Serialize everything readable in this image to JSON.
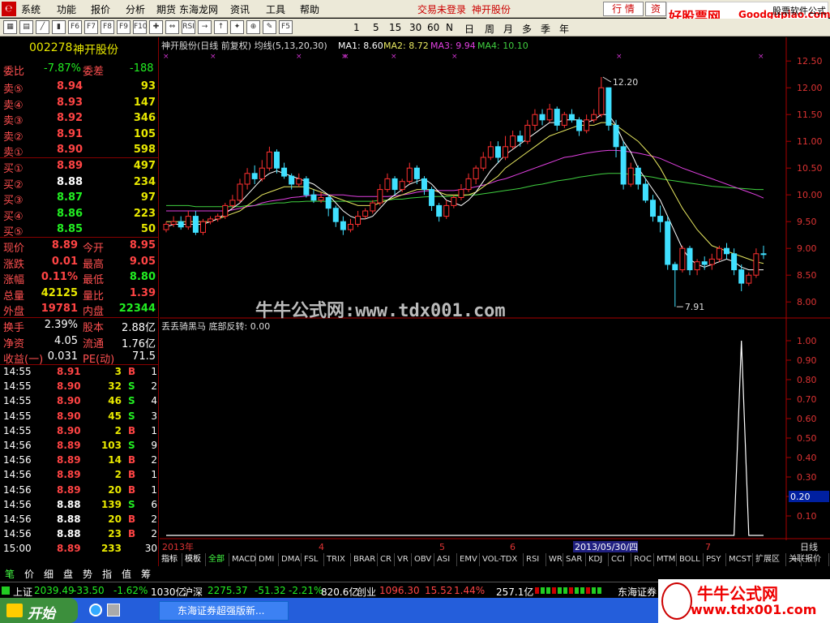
{
  "menubar": {
    "items": [
      "系统",
      "功能",
      "报价",
      "分析",
      "期货",
      "东海龙网",
      "资讯",
      "工具",
      "帮助"
    ],
    "status": "交易未登录",
    "stock_name": "神开股份",
    "btn_quote": "行 情",
    "btn_trade": "资"
  },
  "watermark_top": {
    "text1": "好股票网",
    "text2": "Goodgupiao.com",
    "corner": "股票软件公式"
  },
  "toolbar": {
    "icons": [
      "grid-icon",
      "table-icon",
      "line-icon",
      "bar-icon",
      "F6",
      "F7",
      "F8",
      "F9",
      "F10",
      "cross-icon",
      "arrows-icon",
      "RSI",
      "right-icon",
      "up-icon",
      "pin-icon",
      "zoom-icon",
      "pen-icon",
      "F5"
    ],
    "periods": [
      "1",
      "5",
      "15",
      "30",
      "60",
      "N",
      "日",
      "周",
      "月",
      "多",
      "季",
      "年"
    ]
  },
  "stock": {
    "code": "002278",
    "name": "神开股份"
  },
  "quote": {
    "weibi_label": "委比",
    "weibi": "-7.87%",
    "weicha_label": "委差",
    "weicha": "-188",
    "sell": [
      {
        "label": "卖⑤",
        "price": "8.94",
        "vol": "93"
      },
      {
        "label": "卖④",
        "price": "8.93",
        "vol": "147"
      },
      {
        "label": "卖③",
        "price": "8.92",
        "vol": "346"
      },
      {
        "label": "卖②",
        "price": "8.91",
        "vol": "105"
      },
      {
        "label": "卖①",
        "price": "8.90",
        "vol": "598"
      }
    ],
    "buy": [
      {
        "label": "买①",
        "price": "8.89",
        "vol": "497"
      },
      {
        "label": "买②",
        "price": "8.88",
        "vol": "234"
      },
      {
        "label": "买③",
        "price": "8.87",
        "vol": "97"
      },
      {
        "label": "买④",
        "price": "8.86",
        "vol": "223"
      },
      {
        "label": "买⑤",
        "price": "8.85",
        "vol": "50"
      }
    ],
    "stats": [
      {
        "l1": "现价",
        "v1": "8.89",
        "l2": "今开",
        "v2": "8.95"
      },
      {
        "l1": "涨跌",
        "v1": "0.01",
        "l2": "最高",
        "v2": "9.05"
      },
      {
        "l1": "涨幅",
        "v1": "0.11%",
        "l2": "最低",
        "v2": "8.80"
      },
      {
        "l1": "总量",
        "v1": "42125",
        "l2": "量比",
        "v2": "1.39"
      },
      {
        "l1": "外盘",
        "v1": "19781",
        "l2": "内盘",
        "v2": "22344"
      }
    ],
    "fund": [
      {
        "l1": "换手",
        "v1": "2.39%",
        "l2": "股本",
        "v2": "2.88亿"
      },
      {
        "l1": "净资",
        "v1": "4.05",
        "l2": "流通",
        "v2": "1.76亿"
      },
      {
        "l1": "收益(一)",
        "v1": "0.031",
        "l2": "PE(动)",
        "v2": "71.5"
      }
    ]
  },
  "ticks": [
    {
      "t": "14:55",
      "p": "8.91",
      "v": "3",
      "s": "B",
      "n": "1"
    },
    {
      "t": "14:55",
      "p": "8.90",
      "v": "32",
      "s": "S",
      "n": "2"
    },
    {
      "t": "14:55",
      "p": "8.90",
      "v": "46",
      "s": "S",
      "n": "4"
    },
    {
      "t": "14:55",
      "p": "8.90",
      "v": "45",
      "s": "S",
      "n": "3"
    },
    {
      "t": "14:55",
      "p": "8.90",
      "v": "2",
      "s": "B",
      "n": "1"
    },
    {
      "t": "14:56",
      "p": "8.89",
      "v": "103",
      "s": "S",
      "n": "9"
    },
    {
      "t": "14:56",
      "p": "8.89",
      "v": "14",
      "s": "B",
      "n": "2"
    },
    {
      "t": "14:56",
      "p": "8.89",
      "v": "2",
      "s": "B",
      "n": "1"
    },
    {
      "t": "14:56",
      "p": "8.89",
      "v": "20",
      "s": "B",
      "n": "1"
    },
    {
      "t": "14:56",
      "p": "8.88",
      "v": "139",
      "s": "S",
      "n": "6"
    },
    {
      "t": "14:56",
      "p": "8.88",
      "v": "20",
      "s": "B",
      "n": "2"
    },
    {
      "t": "14:56",
      "p": "8.88",
      "v": "23",
      "s": "B",
      "n": "2"
    },
    {
      "t": "15:00",
      "p": "8.89",
      "v": "233",
      "s": "",
      "n": "30"
    }
  ],
  "chart": {
    "title": "神开股份(日线 前复权) 均线(5,13,20,30)",
    "ma1": "MA1: 8.60",
    "ma2": "MA2: 8.72",
    "ma3": "MA3: 9.94",
    "ma4": "MA4: 10.10",
    "high_label": "12.20",
    "low_label": "7.91",
    "watermark": "牛牛公式网:www.tdx001.com",
    "price_ticks": [
      "12.50",
      "12.00",
      "11.50",
      "11.00",
      "10.50",
      "10.00",
      "9.50",
      "9.00",
      "8.50",
      "8.00"
    ],
    "indicator_title": "丢丢骑黑马 底部反转: 0.00",
    "ind_ticks": [
      "1.00",
      "0.90",
      "0.80",
      "0.70",
      "0.60",
      "0.50",
      "0.40",
      "0.30",
      "0.20",
      "0.10"
    ],
    "ind_cursor": "0.20",
    "date_labels": [
      "2013年",
      "4",
      "5",
      "6",
      "7"
    ],
    "date_cursor": "2013/05/30/四",
    "period_label": "日线",
    "colors": {
      "up": "#ff3030",
      "down": "#40e0ff",
      "ma1": "#ffffff",
      "ma2": "#e8e860",
      "ma3": "#e040e0",
      "ma4": "#40d040"
    }
  },
  "indicator_tabs": [
    "指标",
    "模板",
    "全部",
    "MACD",
    "DMI",
    "DMA",
    "FSL",
    "TRIX",
    "BRAR",
    "CR",
    "VR",
    "OBV",
    "ASI",
    "EMV",
    "VOL-TDX",
    "RSI",
    "WR",
    "SAR",
    "KDJ",
    "CCI",
    "ROC",
    "MTM",
    "BOLL",
    "PSY",
    "MCST",
    "扩展区",
    "关联报价"
  ],
  "tab_nav": [
    "+",
    "-"
  ],
  "left_tabs": [
    "笔",
    "价",
    "细",
    "盘",
    "势",
    "指",
    "值",
    "筹"
  ],
  "index_bar": [
    {
      "name": "上证",
      "val": "2039.49",
      "chg": "-33.50",
      "pct": "-1.62%",
      "amt": "1030亿"
    },
    {
      "name": "沪深",
      "val": "2275.37",
      "chg": "-51.32",
      "pct": "-2.21%",
      "amt": "820.6亿"
    },
    {
      "name": "创业",
      "val": "1096.30",
      "chg": "15.52",
      "pct": "1.44%",
      "amt": "257.1亿"
    }
  ],
  "broker": "东海证券",
  "taskbar": {
    "start": "开始",
    "task1": "东海证券超强版新..."
  },
  "watermark_bottom": {
    "text1": "牛牛公式网",
    "text2": "www.tdx001.com"
  },
  "chart_data": {
    "type": "candlestick",
    "title": "神开股份(日线 前复权) 均线(5,13,20,30)",
    "ylim": [
      7.7,
      12.7
    ],
    "indicator_ylim": [
      0,
      1.05
    ],
    "candles": [
      [
        9.35,
        9.45,
        9.3,
        9.5
      ],
      [
        9.45,
        9.5,
        9.4,
        9.6
      ],
      [
        9.5,
        9.4,
        9.35,
        9.6
      ],
      [
        9.4,
        9.6,
        9.35,
        9.7
      ],
      [
        9.6,
        9.3,
        9.25,
        9.7
      ],
      [
        9.3,
        9.5,
        9.25,
        9.55
      ],
      [
        9.5,
        9.55,
        9.45,
        9.6
      ],
      [
        9.55,
        9.6,
        9.5,
        9.65
      ],
      [
        9.6,
        9.8,
        9.55,
        9.85
      ],
      [
        9.8,
        9.9,
        9.75,
        10.0
      ],
      [
        9.9,
        10.2,
        9.85,
        10.3
      ],
      [
        10.2,
        10.4,
        10.1,
        10.5
      ],
      [
        10.4,
        10.3,
        10.2,
        10.55
      ],
      [
        10.3,
        10.5,
        10.25,
        10.65
      ],
      [
        10.5,
        10.8,
        10.45,
        10.9
      ],
      [
        10.8,
        10.5,
        10.4,
        10.85
      ],
      [
        10.5,
        10.35,
        10.3,
        10.6
      ],
      [
        10.35,
        10.2,
        10.1,
        10.4
      ],
      [
        10.2,
        10.3,
        10.15,
        10.4
      ],
      [
        10.3,
        10.0,
        9.95,
        10.35
      ],
      [
        10.0,
        9.9,
        9.85,
        10.1
      ],
      [
        9.9,
        9.95,
        9.85,
        10.05
      ],
      [
        9.95,
        9.75,
        9.6,
        10.0
      ],
      [
        9.75,
        9.5,
        9.4,
        9.8
      ],
      [
        9.5,
        9.35,
        9.25,
        9.6
      ],
      [
        9.35,
        9.45,
        9.3,
        9.55
      ],
      [
        9.45,
        9.6,
        9.4,
        9.7
      ],
      [
        9.6,
        9.7,
        9.55,
        9.75
      ],
      [
        9.7,
        9.85,
        9.65,
        9.9
      ],
      [
        9.85,
        10.1,
        9.8,
        10.2
      ],
      [
        10.1,
        10.3,
        10.05,
        10.4
      ],
      [
        10.3,
        10.1,
        10.0,
        10.35
      ],
      [
        10.1,
        10.25,
        10.05,
        10.3
      ],
      [
        10.25,
        10.5,
        10.2,
        10.6
      ],
      [
        10.5,
        10.3,
        10.2,
        10.55
      ],
      [
        10.3,
        10.1,
        10.0,
        10.35
      ],
      [
        10.1,
        9.8,
        9.7,
        10.15
      ],
      [
        9.8,
        9.6,
        9.5,
        9.85
      ],
      [
        9.6,
        9.8,
        9.55,
        9.9
      ],
      [
        9.8,
        9.95,
        9.75,
        10.0
      ],
      [
        9.95,
        10.1,
        9.9,
        10.2
      ],
      [
        10.1,
        10.3,
        10.05,
        10.4
      ],
      [
        10.3,
        10.5,
        10.2,
        10.55
      ],
      [
        10.5,
        10.7,
        10.45,
        10.8
      ],
      [
        10.7,
        10.9,
        10.65,
        11.0
      ],
      [
        10.9,
        10.7,
        10.6,
        11.0
      ],
      [
        10.7,
        10.9,
        10.65,
        11.1
      ],
      [
        10.9,
        11.1,
        10.85,
        11.2
      ],
      [
        11.1,
        11.0,
        10.9,
        11.2
      ],
      [
        11.0,
        11.3,
        10.95,
        11.4
      ],
      [
        11.3,
        11.5,
        11.2,
        11.6
      ],
      [
        11.5,
        11.4,
        11.3,
        11.6
      ],
      [
        11.4,
        11.6,
        11.35,
        11.7
      ],
      [
        11.6,
        11.3,
        11.2,
        11.65
      ],
      [
        11.3,
        11.5,
        11.25,
        11.55
      ],
      [
        11.5,
        11.4,
        11.35,
        11.6
      ],
      [
        11.4,
        11.2,
        11.1,
        11.45
      ],
      [
        11.2,
        11.4,
        11.15,
        11.5
      ],
      [
        11.4,
        11.5,
        11.35,
        11.6
      ],
      [
        11.5,
        12.0,
        11.45,
        12.2
      ],
      [
        12.0,
        11.3,
        11.2,
        12.0
      ],
      [
        11.3,
        10.9,
        10.7,
        11.4
      ],
      [
        10.9,
        10.2,
        10.1,
        11.0
      ],
      [
        10.2,
        10.5,
        10.15,
        10.6
      ],
      [
        10.5,
        10.2,
        10.1,
        10.55
      ],
      [
        10.2,
        9.9,
        9.85,
        10.3
      ],
      [
        9.9,
        9.6,
        9.5,
        10.0
      ],
      [
        9.6,
        9.5,
        9.3,
        9.8
      ],
      [
        9.5,
        8.7,
        8.6,
        9.6
      ],
      [
        8.7,
        8.6,
        7.91,
        8.75
      ],
      [
        8.6,
        9.0,
        8.55,
        9.05
      ],
      [
        9.0,
        8.6,
        8.5,
        9.05
      ],
      [
        8.6,
        8.75,
        8.5,
        8.8
      ],
      [
        8.75,
        8.7,
        8.6,
        8.85
      ],
      [
        8.7,
        8.8,
        8.6,
        8.9
      ],
      [
        8.8,
        9.0,
        8.75,
        9.05
      ],
      [
        9.0,
        8.9,
        8.8,
        9.1
      ],
      [
        8.9,
        8.6,
        8.5,
        9.0
      ],
      [
        8.6,
        8.35,
        8.2,
        8.7
      ],
      [
        8.35,
        8.5,
        8.3,
        8.55
      ],
      [
        8.5,
        8.9,
        8.45,
        9.0
      ],
      [
        8.9,
        8.89,
        8.8,
        9.05
      ]
    ],
    "ma1": [
      9.4,
      9.45,
      9.45,
      9.45,
      9.45,
      9.45,
      9.5,
      9.55,
      9.65,
      9.75,
      9.85,
      10.0,
      10.15,
      10.3,
      10.4,
      10.45,
      10.4,
      10.35,
      10.3,
      10.25,
      10.2,
      10.1,
      10.0,
      9.85,
      9.7,
      9.6,
      9.55,
      9.55,
      9.6,
      9.75,
      9.9,
      10.0,
      10.1,
      10.2,
      10.25,
      10.3,
      10.2,
      10.05,
      9.9,
      9.85,
      9.8,
      9.9,
      10.05,
      10.25,
      10.45,
      10.6,
      10.75,
      10.85,
      10.95,
      11.05,
      11.15,
      11.25,
      11.35,
      11.35,
      11.4,
      11.4,
      11.4,
      11.35,
      11.4,
      11.5,
      11.5,
      11.3,
      11.0,
      10.8,
      10.5,
      10.3,
      10.1,
      9.9,
      9.6,
      9.3,
      9.0,
      8.8,
      8.7,
      8.65,
      8.7,
      8.75,
      8.8,
      8.75,
      8.65,
      8.6,
      8.6,
      8.6
    ],
    "ma2": [
      9.5,
      9.5,
      9.5,
      9.5,
      9.5,
      9.5,
      9.5,
      9.55,
      9.6,
      9.65,
      9.7,
      9.8,
      9.9,
      10.0,
      10.05,
      10.1,
      10.15,
      10.15,
      10.15,
      10.15,
      10.1,
      10.05,
      10.0,
      9.95,
      9.9,
      9.85,
      9.8,
      9.8,
      9.8,
      9.85,
      9.9,
      9.95,
      10.0,
      10.05,
      10.1,
      10.1,
      10.1,
      10.05,
      10.0,
      10.0,
      10.0,
      10.0,
      10.05,
      10.15,
      10.25,
      10.35,
      10.5,
      10.6,
      10.7,
      10.8,
      10.9,
      11.0,
      11.1,
      11.15,
      11.2,
      11.25,
      11.3,
      11.3,
      11.3,
      11.35,
      11.35,
      11.3,
      11.2,
      11.1,
      11.0,
      10.85,
      10.7,
      10.5,
      10.25,
      10.0,
      9.75,
      9.55,
      9.35,
      9.2,
      9.05,
      9.0,
      8.95,
      8.9,
      8.85,
      8.8,
      8.75,
      8.72
    ],
    "ma3": [
      9.7,
      9.7,
      9.7,
      9.7,
      9.7,
      9.7,
      9.7,
      9.7,
      9.7,
      9.72,
      9.75,
      9.78,
      9.8,
      9.85,
      9.88,
      9.9,
      9.92,
      9.95,
      9.96,
      9.98,
      10.0,
      10.0,
      10.0,
      10.0,
      10.0,
      9.98,
      9.97,
      9.97,
      9.97,
      9.97,
      9.97,
      9.98,
      10.0,
      10.02,
      10.05,
      10.07,
      10.08,
      10.08,
      10.08,
      10.08,
      10.1,
      10.12,
      10.15,
      10.18,
      10.22,
      10.27,
      10.3,
      10.35,
      10.4,
      10.45,
      10.5,
      10.55,
      10.6,
      10.65,
      10.7,
      10.72,
      10.75,
      10.78,
      10.8,
      10.82,
      10.83,
      10.83,
      10.82,
      10.8,
      10.78,
      10.75,
      10.72,
      10.68,
      10.62,
      10.56,
      10.5,
      10.45,
      10.4,
      10.35,
      10.3,
      10.25,
      10.2,
      10.15,
      10.1,
      10.05,
      10.0,
      9.94
    ],
    "ma4": [
      9.8,
      9.8,
      9.8,
      9.8,
      9.78,
      9.78,
      9.78,
      9.78,
      9.78,
      9.78,
      9.78,
      9.8,
      9.8,
      9.82,
      9.83,
      9.85,
      9.85,
      9.87,
      9.87,
      9.88,
      9.88,
      9.88,
      9.88,
      9.88,
      9.88,
      9.88,
      9.88,
      9.88,
      9.88,
      9.9,
      9.9,
      9.92,
      9.92,
      9.94,
      9.95,
      9.96,
      9.97,
      9.97,
      9.97,
      9.98,
      9.98,
      10.0,
      10.0,
      10.02,
      10.04,
      10.06,
      10.08,
      10.1,
      10.12,
      10.15,
      10.18,
      10.2,
      10.23,
      10.26,
      10.28,
      10.3,
      10.33,
      10.35,
      10.37,
      10.39,
      10.4,
      10.4,
      10.4,
      10.38,
      10.37,
      10.35,
      10.33,
      10.3,
      10.28,
      10.26,
      10.24,
      10.22,
      10.2,
      10.18,
      10.16,
      10.15,
      10.14,
      10.13,
      10.12,
      10.11,
      10.1,
      10.1
    ],
    "indicator": [
      0,
      0,
      0,
      0,
      0,
      0,
      0,
      0,
      0,
      0,
      0,
      0,
      0,
      0,
      0,
      0,
      0,
      0,
      0,
      0,
      0,
      0,
      0,
      0,
      0,
      0,
      0,
      0,
      0,
      0,
      0,
      0,
      0,
      0,
      0,
      0,
      0,
      0,
      0,
      0,
      0,
      0,
      0,
      0,
      0,
      0,
      0,
      0,
      0,
      0,
      0,
      0,
      0,
      0,
      0,
      0,
      0,
      0,
      0,
      0,
      0,
      0,
      0,
      0,
      0,
      0,
      0,
      0,
      0,
      0,
      0,
      0,
      0,
      0,
      0,
      0,
      0,
      0,
      1,
      0,
      0,
      0
    ]
  }
}
